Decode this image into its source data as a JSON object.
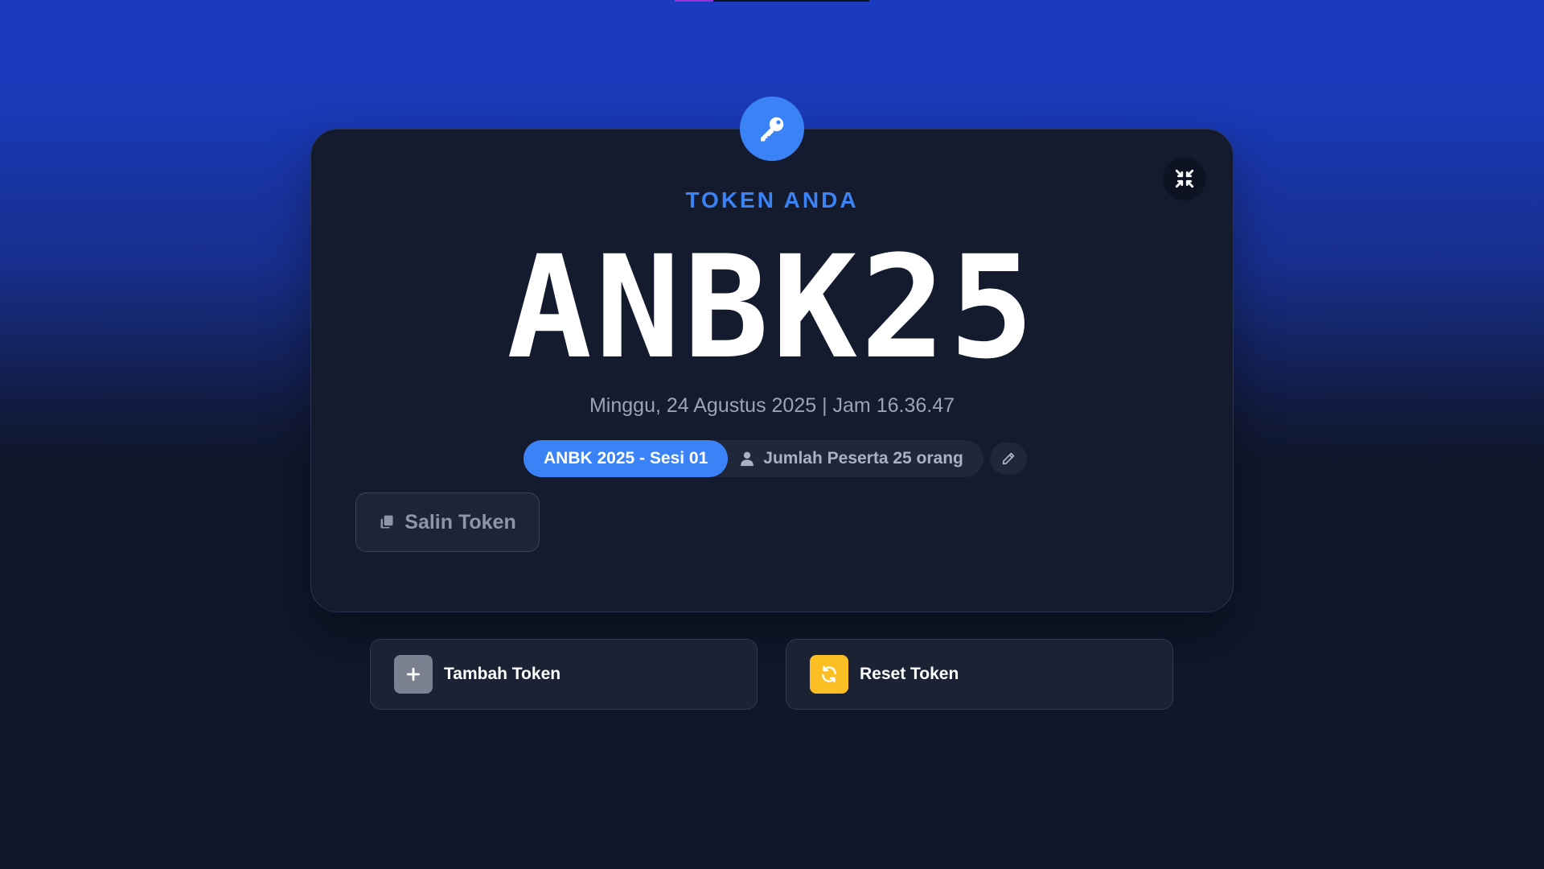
{
  "progress": {
    "fraction": 0.2,
    "color": "#9d2fd8"
  },
  "colors": {
    "accent": "#3b82f6",
    "warning": "#fbbf24",
    "background": "#0f172a",
    "card": "#141b2e"
  },
  "token_card": {
    "icon": "key-icon",
    "label": "TOKEN ANDA",
    "token": "ANBK25",
    "datetime": "Minggu, 24 Agustus 2025 | Jam 16.36.47",
    "session": "ANBK 2025 - Sesi 01",
    "participants": "Jumlah Peserta 25 orang",
    "participants_icon": "user-icon",
    "edit_icon": "pencil-icon",
    "close_icon": "exit-fullscreen-icon",
    "copy_button": {
      "label": "Salin Token",
      "icon": "copy-icon"
    }
  },
  "actions": [
    {
      "label": "Tambah Token",
      "icon": "plus-icon"
    },
    {
      "label": "Reset Token",
      "icon": "refresh-icon"
    }
  ]
}
